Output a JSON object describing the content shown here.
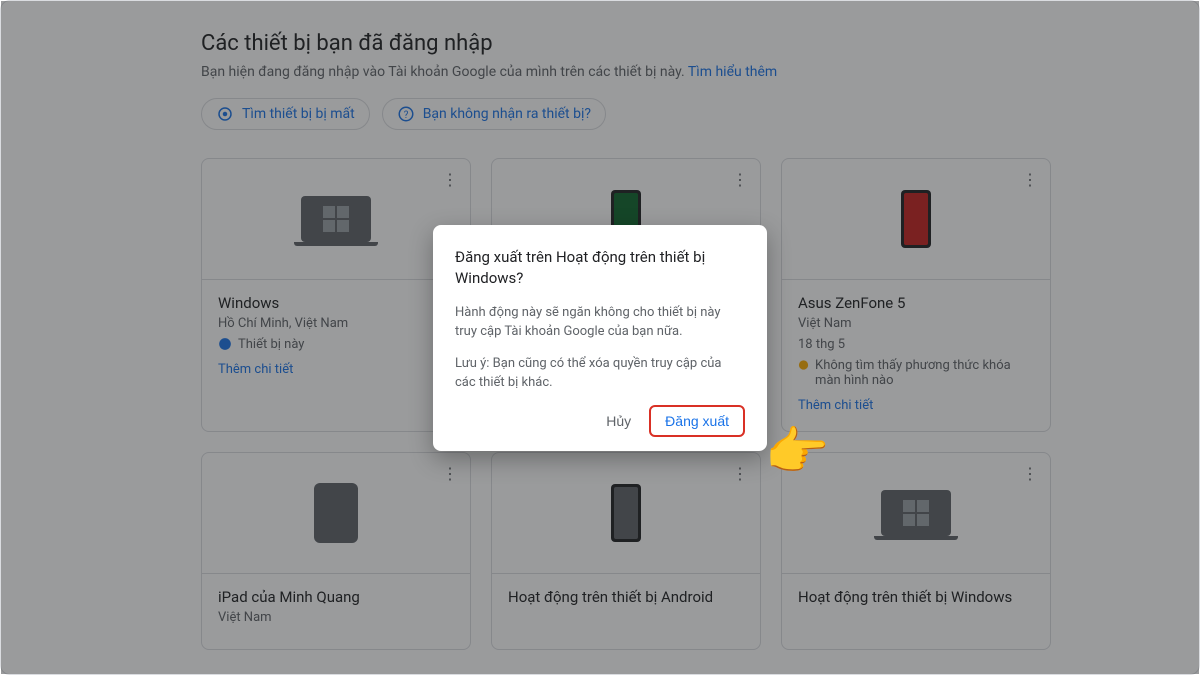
{
  "header": {
    "title": "Các thiết bị bạn đã đăng nhập",
    "subtitle": "Bạn hiện đang đăng nhập vào Tài khoản Google của mình trên các thiết bị này.",
    "learn_more": "Tìm hiểu thêm"
  },
  "chips": {
    "find": "Tìm thiết bị bị mất",
    "unknown": "Bạn không nhận ra thiết bị?"
  },
  "devices": [
    {
      "name": "Windows",
      "location": "Hồ Chí Minh, Việt Nam",
      "this_device": "Thiết bị này",
      "details": "Thêm chi tiết",
      "icon": "laptop"
    },
    {
      "name": "",
      "location": "",
      "icon": "phone-green"
    },
    {
      "name": "Asus ZenFone 5",
      "location": "Việt Nam",
      "date": "18 thg 5",
      "warning": "Không tìm thấy phương thức khóa màn hình nào",
      "details": "Thêm chi tiết",
      "icon": "phone-pink"
    },
    {
      "name": "iPad của Minh Quang",
      "location": "Việt Nam",
      "icon": "tablet"
    },
    {
      "name": "Hoạt động trên thiết bị Android",
      "icon": "phone-gray"
    },
    {
      "name": "Hoạt động trên thiết bị Windows",
      "icon": "laptop"
    }
  ],
  "dialog": {
    "title": "Đăng xuất trên Hoạt động trên thiết bị Windows?",
    "body1": "Hành động này sẽ ngăn không cho thiết bị này truy cập Tài khoản Google của bạn nữa.",
    "body2": "Lưu ý: Bạn cũng có thể xóa quyền truy cập của các thiết bị khác.",
    "cancel": "Hủy",
    "confirm": "Đăng xuất"
  }
}
